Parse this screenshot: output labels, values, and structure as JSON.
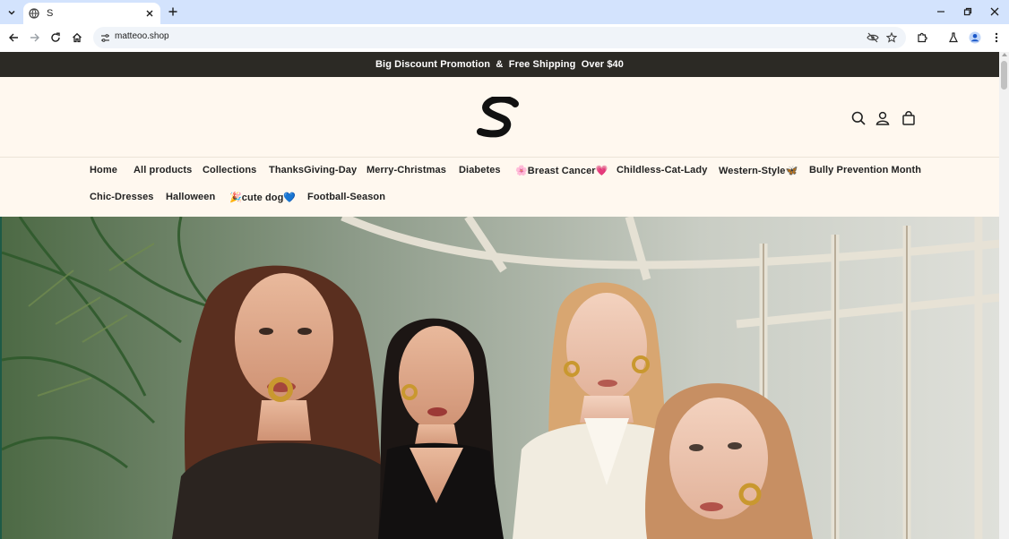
{
  "browser": {
    "tab": {
      "title": "S",
      "favicon": "globe-icon"
    },
    "url": "matteoo.shop",
    "controls": [
      "minimize-icon",
      "restore-icon",
      "close-icon"
    ]
  },
  "announcement": "Big Discount Promotion  &  Free Shipping  Over $40",
  "header": {
    "logo_letter": "S",
    "icons": [
      "search-icon",
      "account-icon",
      "cart-icon"
    ]
  },
  "nav": {
    "items": [
      "Home",
      "All products",
      "Collections",
      "ThanksGiving-Day",
      "Merry-Christmas",
      "Diabetes",
      "🌸Breast Cancer💗",
      "Childless-Cat-Lady",
      "Western-Style🦋",
      "Bully Prevention Month",
      "Chic-Dresses",
      "Halloween",
      "🎉cute dog💙",
      "Football-Season"
    ]
  },
  "colors": {
    "announcement_bg": "#2c2a25",
    "page_bg": "#fff8ef",
    "chrome_bg": "#d3e3fd"
  }
}
